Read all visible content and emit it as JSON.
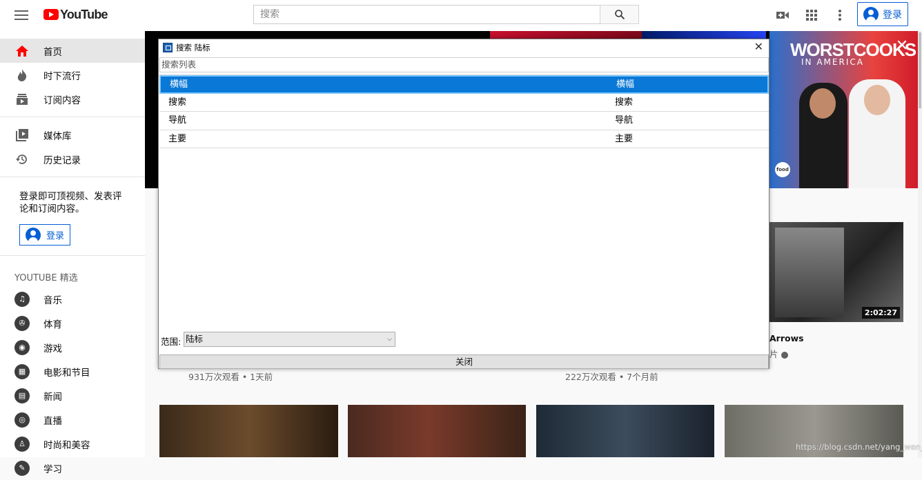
{
  "header": {
    "logo_text": "YouTube",
    "search_placeholder": "搜索",
    "signin_label": "登录"
  },
  "sidebar": {
    "items": [
      {
        "label": "首页",
        "icon": "home-icon"
      },
      {
        "label": "时下流行",
        "icon": "flame-icon"
      },
      {
        "label": "订阅内容",
        "icon": "subscriptions-icon"
      }
    ],
    "library_items": [
      {
        "label": "媒体库",
        "icon": "library-icon"
      },
      {
        "label": "历史记录",
        "icon": "history-icon"
      }
    ],
    "signin_text": "登录即可顶视频、发表评论和订阅内容。",
    "signin_button": "登录",
    "section_title": "YOUTUBE 精选",
    "featured": [
      {
        "label": "音乐",
        "icon": "music-icon"
      },
      {
        "label": "体育",
        "icon": "sports-icon"
      },
      {
        "label": "游戏",
        "icon": "gaming-icon"
      },
      {
        "label": "电影和节目",
        "icon": "movies-icon"
      },
      {
        "label": "新闻",
        "icon": "news-icon"
      },
      {
        "label": "直播",
        "icon": "live-icon"
      },
      {
        "label": "时尚和美容",
        "icon": "fashion-icon"
      },
      {
        "label": "学习",
        "icon": "learning-icon"
      }
    ]
  },
  "banner": {
    "promo_title": "WORSTCOOKS",
    "promo_subtitle": "IN AMERICA",
    "promo_logo": "food"
  },
  "videos": {
    "row1": [
      {
        "meta": "931万次观看 • 1天前"
      },
      {
        "meta": "222万次观看 • 7个月前"
      },
      {
        "title_fragment": "Arrows",
        "channel_fragment": "片",
        "duration": "2:02:27"
      }
    ]
  },
  "dialog": {
    "title": "搜索 陆标",
    "list_label": "搜索列表",
    "rows": [
      {
        "c1": "横幅",
        "c2": "横幅",
        "selected": true
      },
      {
        "c1": "搜索",
        "c2": "搜索"
      },
      {
        "c1": "导航",
        "c2": "导航"
      },
      {
        "c1": "主要",
        "c2": "主要"
      }
    ],
    "scope_label": "范围:",
    "scope_value": "陆标",
    "close_label": "关闭"
  },
  "watermark": "https://blog.csdn.net/yang_wen_wu"
}
